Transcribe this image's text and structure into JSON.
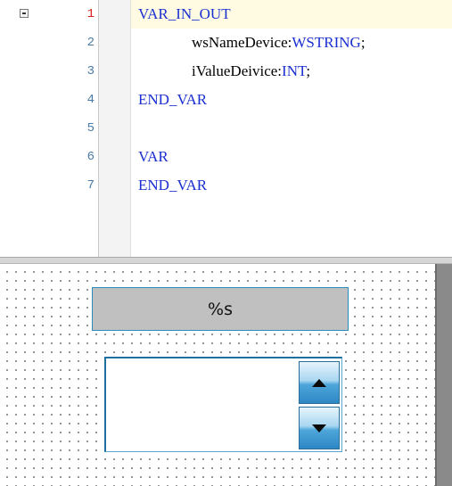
{
  "editor": {
    "lines": [
      {
        "num": "1",
        "kw1": "VAR_IN_OUT",
        "id": "",
        "sep": "",
        "kw2": "",
        "end": ""
      },
      {
        "num": "2",
        "kw1": "",
        "id": "wsNameDevice",
        "sep": ":",
        "kw2": "WSTRING",
        "end": ";"
      },
      {
        "num": "3",
        "kw1": "",
        "id": "iValueDeivice",
        "sep": ":",
        "kw2": "INT",
        "end": ";"
      },
      {
        "num": "4",
        "kw1": "END_VAR",
        "id": "",
        "sep": "",
        "kw2": "",
        "end": ""
      },
      {
        "num": "5",
        "kw1": "",
        "id": "",
        "sep": "",
        "kw2": "",
        "end": ""
      },
      {
        "num": "6",
        "kw1": "VAR",
        "id": "",
        "sep": "",
        "kw2": "",
        "end": ""
      },
      {
        "num": "7",
        "kw1": "END_VAR",
        "id": "",
        "sep": "",
        "kw2": "",
        "end": ""
      }
    ]
  },
  "canvas": {
    "label_text": "%s",
    "spin_value": "",
    "spin_up_icon": "triangle-up-icon",
    "spin_down_icon": "triangle-down-icon"
  },
  "colors": {
    "keyword": "#1a2fd0",
    "current_line": "#fefbe2",
    "current_line_number": "#d8201c",
    "line_number": "#4a7aa6",
    "accent": "#2a8bbf"
  }
}
